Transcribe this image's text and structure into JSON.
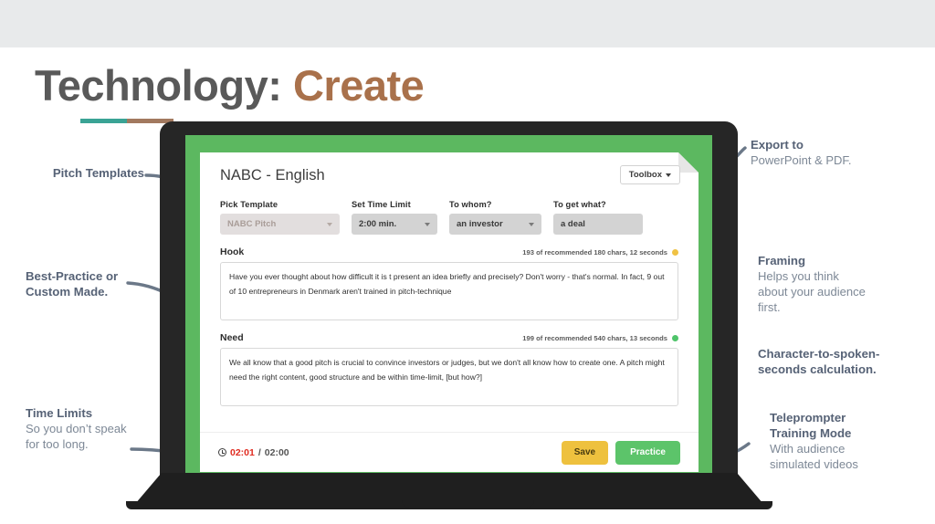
{
  "slide": {
    "title_primary": "Technology:",
    "title_accent": "Create",
    "accent_teal": "#3aa395",
    "accent_brown": "#a2795f"
  },
  "app": {
    "title": "NABC - English",
    "toolbox_label": "Toolbox",
    "fields": [
      {
        "label": "Pick Template",
        "value": "NABC Pitch",
        "muted": true,
        "has_caret": true
      },
      {
        "label": "Set Time Limit",
        "value": "2:00 min.",
        "muted": false,
        "has_caret": true
      },
      {
        "label": "To whom?",
        "value": "an investor",
        "muted": false,
        "has_caret": true
      },
      {
        "label": "To get what?",
        "value": "a deal",
        "muted": false,
        "has_caret": false
      }
    ],
    "sections": [
      {
        "title": "Hook",
        "counter": "193 of recommended 180 chars, 12 seconds",
        "status_color": "#f0c244",
        "text": "Have you ever thought about how difficult it is t present an idea briefly and precisely? Don't worry - that's normal. In fact, 9 out of 10 entrepreneurs in Denmark aren't trained in pitch-technique"
      },
      {
        "title": "Need",
        "counter": "199 of recommended 540 chars, 13 seconds",
        "status_color": "#4fc46a",
        "text": "We all know that a good pitch is crucial to convince investors or judges, but we don't all know how to create one. A pitch might need the right content, good structure and be within time-limit, [but how?]"
      }
    ],
    "footer": {
      "time_current": "02:01",
      "time_separator": "/",
      "time_total": "02:00",
      "save_label": "Save",
      "practice_label": "Practice",
      "save_color": "#eec13e",
      "practice_color": "#5cc46a"
    },
    "screen_background": "#5cb860"
  },
  "annotations": {
    "left": [
      {
        "heading": "Pitch Templates",
        "body": ""
      },
      {
        "heading": "Best-Practice or\nCustom Made.",
        "body": ""
      },
      {
        "heading": "Time Limits",
        "body": "So you don’t speak\nfor too long."
      }
    ],
    "right": [
      {
        "heading": "Export to",
        "body": "PowerPoint & PDF."
      },
      {
        "heading": "Framing",
        "body": "Helps you think\nabout your audience\nfirst."
      },
      {
        "heading": "Character-to-spoken-\nseconds calculation.",
        "body": ""
      },
      {
        "heading": "Teleprompter\nTraining Mode",
        "body": "With audience\nsimulated videos"
      }
    ]
  }
}
